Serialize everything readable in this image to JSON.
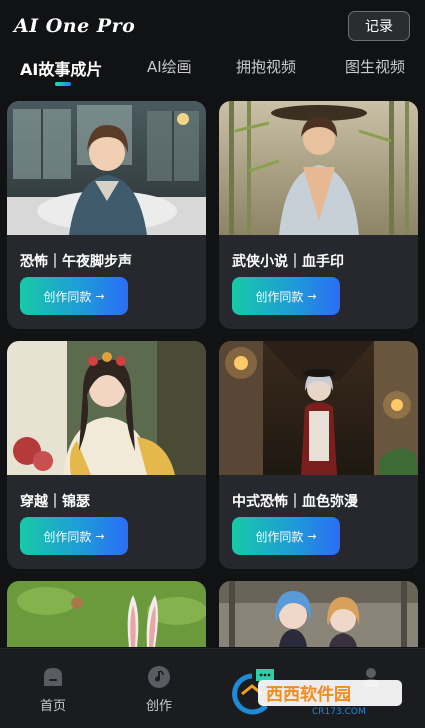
{
  "header": {
    "app_title": "AI One Pro",
    "record_label": "记录"
  },
  "tabs": [
    {
      "label": "AI故事成片",
      "active": true
    },
    {
      "label": "AI绘画",
      "active": false
    },
    {
      "label": "拥抱视频",
      "active": false
    },
    {
      "label": "图生视频",
      "active": false
    }
  ],
  "cards": [
    {
      "title": "恐怖｜午夜脚步声",
      "button": "创作同款"
    },
    {
      "title": "武侠小说｜血手印",
      "button": "创作同款"
    },
    {
      "title": "穿越｜锦瑟",
      "button": "创作同款"
    },
    {
      "title": "中式恐怖｜血色弥漫",
      "button": "创作同款"
    }
  ],
  "button_arrow": "→",
  "bottom_nav": [
    {
      "label": "首页",
      "icon": "home-icon"
    },
    {
      "label": "创作",
      "icon": "music-note-icon"
    },
    {
      "label": "",
      "icon": "chat-icon"
    },
    {
      "label": "",
      "icon": "profile-icon"
    }
  ],
  "watermark": {
    "brand": "西西软件园",
    "url": "CR173.COM"
  },
  "colors": {
    "background": "#111214",
    "card": "#26282d",
    "accent_start": "#18c9a6",
    "accent_end": "#2a6ef5"
  }
}
